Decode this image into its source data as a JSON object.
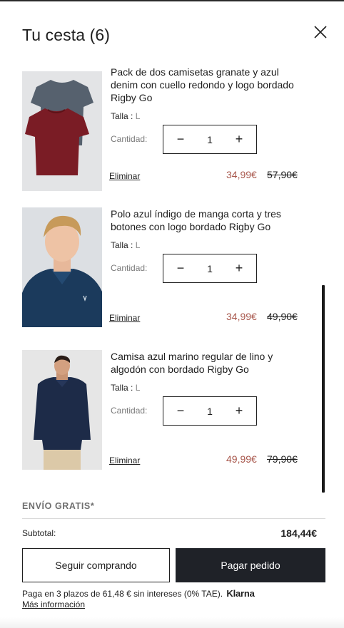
{
  "header": {
    "title": "Tu cesta (6)"
  },
  "icons": {
    "close": "close-icon",
    "minus": "minus-icon",
    "plus": "plus-icon"
  },
  "cart": {
    "items": [
      {
        "title": "Pack de dos camisetas granate y azul denim con cuello redondo y logo bordado Rigby Go",
        "size_label": "Talla :",
        "size_value": "L",
        "qty_label": "Cantidad:",
        "qty_value": "1",
        "remove_label": "Eliminar",
        "price_sale": "34,99€",
        "price_old": "57,90€"
      },
      {
        "title": "Polo azul índigo de manga corta y tres botones con logo bordado Rigby Go",
        "size_label": "Talla :",
        "size_value": "L",
        "qty_label": "Cantidad:",
        "qty_value": "1",
        "remove_label": "Eliminar",
        "price_sale": "34,99€",
        "price_old": "49,90€"
      },
      {
        "title": "Camisa azul marino regular de lino y algodón con bordado Rigby Go",
        "size_label": "Talla :",
        "size_value": "L",
        "qty_label": "Cantidad:",
        "qty_value": "1",
        "remove_label": "Eliminar",
        "price_sale": "49,99€",
        "price_old": "79,90€"
      }
    ]
  },
  "summary": {
    "shipping": "ENVÍO GRATIS*",
    "subtotal_label": "Subtotal:",
    "subtotal_value": "184,44€"
  },
  "actions": {
    "continue_label": "Seguir comprando",
    "pay_label": "Pagar pedido"
  },
  "financing": {
    "text": "Paga en 3 plazos de 61,48 € sin intereses (0% TAE).",
    "brand": "Klarna",
    "more_info": "Más información"
  },
  "colors": {
    "sale_price": "#a8574c",
    "pay_button": "#1f2228",
    "text": "#1f1f1f"
  }
}
